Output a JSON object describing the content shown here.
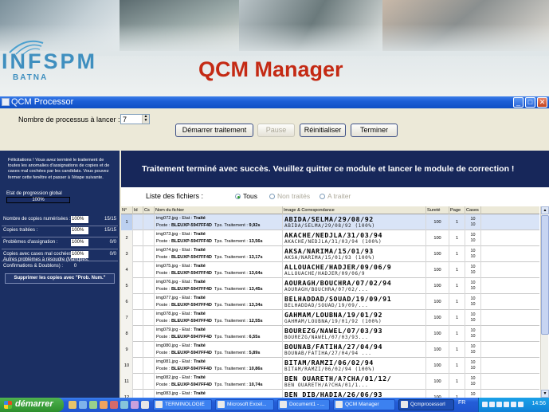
{
  "banner": {
    "logo_text": "INFSPM",
    "logo_sub": "BATNA",
    "app_title": "QCM Manager"
  },
  "window": {
    "title": "QCM Processor",
    "controls": [
      "minimize-icon",
      "maximize-icon",
      "close-icon"
    ]
  },
  "toolbar": {
    "process_label": "Nombre de processus à lancer :",
    "process_value": "7",
    "start_label": "Démarrer traitement",
    "pause_label": "Pause",
    "reset_label": "Réinitialiser",
    "finish_label": "Terminer"
  },
  "left_panel": {
    "congrats": "Félicitations ! Vous avez terminé le traitement de toutes les anomalies d'assignations de copies et de cases mal cochées par les candidats. Vous pouvez fermer cette fenêtre et passer à l'étape suivante.",
    "progress_label": "Etat de progression global",
    "progress_value": "100%",
    "progress_fraction": 1.0,
    "stats": [
      {
        "label": "Nombre de copies numérisées :",
        "pct": "100%",
        "frac": "15/15"
      },
      {
        "label": "Copies traitées :",
        "pct": "100%",
        "frac": "15/15"
      },
      {
        "label": "Problèmes d'assignation :",
        "pct": "100%",
        "frac": "0/0"
      },
      {
        "label": "Copies avec cases mal cochées :",
        "pct": "100%",
        "frac": "0/0"
      }
    ],
    "other_problems": "Autres problèmes à résoudre (Manques, Confirmations & Doublons) :",
    "other_count": "0",
    "delete_button": "Supprimer les copies avec \"Prob. Num.\""
  },
  "main": {
    "success_message": "Traitement terminé avec succès. Veuillez quitter ce module et lancer le module de correction !",
    "list_label": "Liste des fichiers :",
    "filters": [
      {
        "label": "Tous",
        "selected": true
      },
      {
        "label": "Non traités",
        "selected": false
      },
      {
        "label": "A traiter",
        "selected": false
      }
    ],
    "columns": [
      "N°",
      "Id",
      "Cs",
      "Nom du fichier",
      "Image & Correspondance",
      "Sureté",
      "Page",
      "Cases"
    ],
    "rows": [
      {
        "num": "1",
        "file": "img072.jpg",
        "state": "Traité",
        "poste": "BLEUXP-5947FF4D",
        "tps": "9,92s",
        "img": "ABIDA/SELMA/29/08/92",
        "corr": "ABIDA/SELMA/29/08/92 (100%)",
        "surete": "100",
        "page": "1",
        "cases": [
          "10",
          "10"
        ],
        "selected": true
      },
      {
        "num": "2",
        "file": "img073.jpg",
        "state": "Traité",
        "poste": "BLEUXP-5947FF4D",
        "tps": "13,56s",
        "img": "AKACHE/NEDJLA/31/03/94",
        "corr": "AKACHE/NEDJLA/31/03/94 (100%)",
        "surete": "100",
        "page": "1",
        "cases": [
          "10",
          "10"
        ],
        "selected": false
      },
      {
        "num": "3",
        "file": "img074.jpg",
        "state": "Traité",
        "poste": "BLEUXP-5947FF4D",
        "tps": "13,17s",
        "img": "AKSA/NARIMA/15/01/93",
        "corr": "AKSA/NARIMA/15/01/93 (100%)",
        "surete": "100",
        "page": "1",
        "cases": [
          "10",
          "10"
        ],
        "selected": false
      },
      {
        "num": "4",
        "file": "img075.jpg",
        "state": "Traité",
        "poste": "BLEUXP-5947FF4D",
        "tps": "13,64s",
        "img": "ALLOUACHE/HADJER/09/06/9",
        "corr": "ALLOUACHE/HADJER/09/06/9",
        "surete": "100",
        "page": "1",
        "cases": [
          "10",
          "10"
        ],
        "selected": false
      },
      {
        "num": "5",
        "file": "img076.jpg",
        "state": "Traité",
        "poste": "BLEUXP-5947FF4D",
        "tps": "13,45s",
        "img": "AOURAGH/BOUCHRA/07/02/94",
        "corr": "AOURAGH/BOUCHRA/07/02/...",
        "surete": "100",
        "page": "1",
        "cases": [
          "10",
          "10"
        ],
        "selected": false
      },
      {
        "num": "6",
        "file": "img077.jpg",
        "state": "Traité",
        "poste": "BLEUXP-5947FF4D",
        "tps": "13,34s",
        "img": "BELHADDAD/SOUAD/19/09/91",
        "corr": "BELHADDAD/SOUAD/19/09/...",
        "surete": "100",
        "page": "1",
        "cases": [
          "10",
          "10"
        ],
        "selected": false
      },
      {
        "num": "7",
        "file": "img078.jpg",
        "state": "Traité",
        "poste": "BLEUXP-5947FF4D",
        "tps": "12,55s",
        "img": "GAHMAM/LOUBNA/19/01/92",
        "corr": "GAHMAM/LOUBNA/19/01/92 (100%)",
        "surete": "100",
        "page": "1",
        "cases": [
          "10",
          "10"
        ],
        "selected": false
      },
      {
        "num": "8",
        "file": "img079.jpg",
        "state": "Traité",
        "poste": "BLEUXP-5947FF4D",
        "tps": "6,55s",
        "img": "BOUREZG/NAWEL/07/03/93",
        "corr": "BOUREZG/NAWEL/07/03/93...",
        "surete": "100",
        "page": "1",
        "cases": [
          "10",
          "10"
        ],
        "selected": false
      },
      {
        "num": "9",
        "file": "img080.jpg",
        "state": "Traité",
        "poste": "BLEUXP-5947FF4D",
        "tps": "5,89s",
        "img": "BOUNAB/FATIHA/27/04/94",
        "corr": "BOUNAB/FATIHA/27/04/94 ...",
        "surete": "100",
        "page": "1",
        "cases": [
          "10",
          "10"
        ],
        "selected": false
      },
      {
        "num": "10",
        "file": "img081.jpg",
        "state": "Traité",
        "poste": "BLEUXP-5947FF4D",
        "tps": "10,86s",
        "img": "BITAM/RAMZI/06/02/94",
        "corr": "BITAM/RAMZI/06/02/94 (100%)",
        "surete": "100",
        "page": "1",
        "cases": [
          "10",
          "10"
        ],
        "selected": false
      },
      {
        "num": "11",
        "file": "img082.jpg",
        "state": "Traité",
        "poste": "BLEUXP-5947FF4D",
        "tps": "10,74s",
        "img": "BEN OUARETH/A?CHA/01/12/",
        "corr": "BEN OUARETH/A?CHA/01/1...",
        "surete": "100",
        "page": "1",
        "cases": [
          "10",
          "10"
        ],
        "selected": false
      },
      {
        "num": "12",
        "file": "img083.jpg",
        "state": "Traité",
        "poste": "BLEUXP-5947FF4D",
        "tps": "",
        "img": "BEN DIB/HADIA/26/06/93",
        "corr": "",
        "surete": "100",
        "page": "1",
        "cases": [
          "10",
          "10"
        ],
        "selected": false
      }
    ],
    "state_prefix": "- Etat :",
    "poste_prefix": "Poste :",
    "tps_prefix": "Tps. Traitement :"
  },
  "taskbar": {
    "start_label": "démarrer",
    "tasks": [
      {
        "label": "TERMINOLOGIE",
        "active": false
      },
      {
        "label": "Microsoft Excel...",
        "active": false
      },
      {
        "label": "Document1 - ...",
        "active": false
      },
      {
        "label": "QCM Manager",
        "active": false
      },
      {
        "label": "Qcmprocessorl",
        "active": true
      }
    ],
    "lang": "FR",
    "clock": "14:56"
  },
  "colors": {
    "panel_navy": "#1b2f63",
    "banner_title": "#c42a14",
    "logo_blue": "#3f8fbf",
    "xp_blue": "#245ed8"
  }
}
